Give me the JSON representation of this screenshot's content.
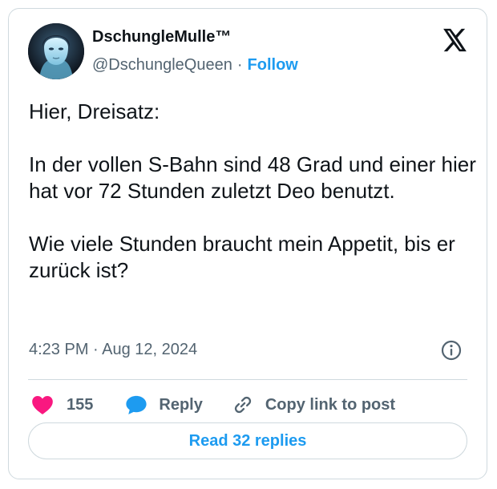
{
  "author": {
    "display_name": "DschungleMulle™",
    "handle": "@DschungleQueen",
    "separator": "·",
    "follow_label": "Follow"
  },
  "tweet": {
    "paragraphs": [
      "Hier, Dreisatz:",
      "In der vollen S-Bahn sind 48 Grad und einer hier hat vor 72 Stunden zuletzt Deo benutzt.",
      "Wie viele Stunden braucht mein Appetit, bis er zurück ist?"
    ],
    "timestamp": "4:23 PM · Aug 12, 2024"
  },
  "actions": {
    "like_count": "155",
    "reply_label": "Reply",
    "copy_link_label": "Copy link to post"
  },
  "read_replies_label": "Read 32 replies",
  "colors": {
    "accent": "#1d9bf0",
    "like": "#f91880",
    "text": "#0f1419",
    "muted": "#536471",
    "border": "#cfd9de"
  },
  "icons": {
    "brand": "x-logo-icon",
    "info": "info-icon",
    "like": "heart-icon",
    "reply": "speech-bubble-icon",
    "copy": "link-icon"
  }
}
